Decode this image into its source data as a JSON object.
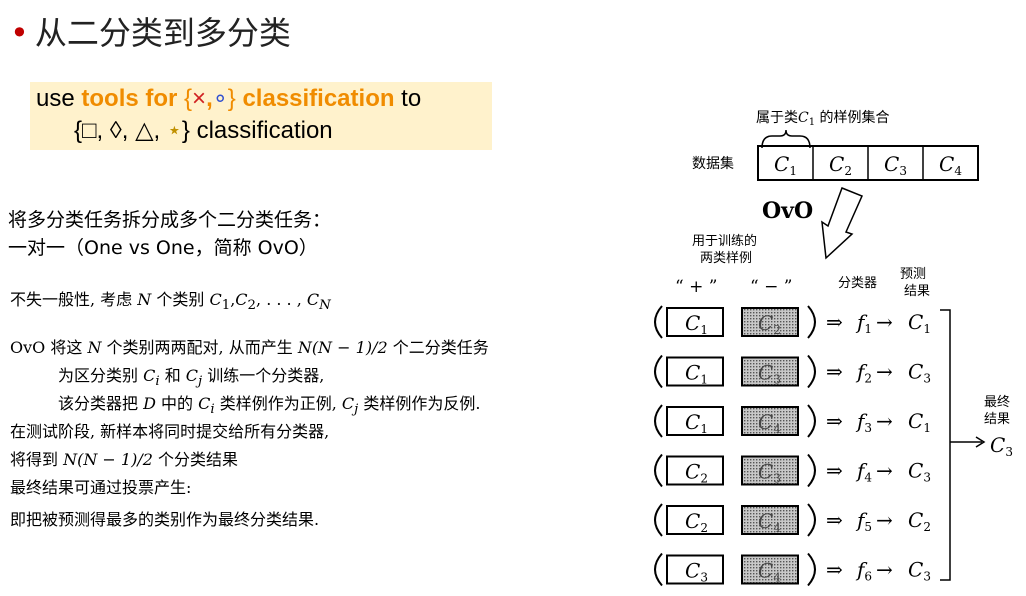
{
  "slide": {
    "bullet": "•",
    "title": "从二分类到多分类"
  },
  "use_box": {
    "w1": "use ",
    "w2": "tools for ",
    "open_brace": "{",
    "cross": "×",
    "comma": ",",
    "circle": "∘",
    "close_brace": "}",
    "w3": " classification",
    "w4": " to",
    "line2_open": "{",
    "square": "□",
    "c1": ", ",
    "diamond": "◊",
    "c2": ", ",
    "triangle": "△",
    "c3": ", ",
    "star": "⋆",
    "line2_close": "}",
    "line2_text": " classification"
  },
  "task": {
    "line1": "将多分类任务拆分成多个二分类任务：",
    "line2": "一对一（One vs One，简称 OvO）"
  },
  "body": {
    "l1_a": "不失一般性, 考虑 ",
    "l1_n": "N",
    "l1_b": " 个类别 ",
    "l1_c": "C",
    "l1_s1": "1",
    "l1_comma1": ",",
    "l1_c2": "C",
    "l1_s2": "2",
    "l1_dots": ", . . . , ",
    "l1_cn": "C",
    "l1_sn": "N",
    "l2_a": "OvO 将这 ",
    "l2_n": "N",
    "l2_b": " 个类别两两配对, 从而产生 ",
    "l2_formula": "N(N − 1)/2",
    "l2_c": " 个二分类任务",
    "l3_a": "为区分类别 ",
    "l3_ci": "C",
    "l3_i": "i",
    "l3_b": " 和 ",
    "l3_cj": "C",
    "l3_j": "j",
    "l3_c": " 训练一个分类器,",
    "l4_a": "该分类器把 ",
    "l4_d": "D",
    "l4_b": " 中的 ",
    "l4_ci": "C",
    "l4_i": "i",
    "l4_c": " 类样例作为正例, ",
    "l4_cj": "C",
    "l4_j": "j",
    "l4_d2": " 类样例作为反例.",
    "l5": "在测试阶段, 新样本将同时提交给所有分类器,",
    "l6_a": "将得到 ",
    "l6_formula": "N(N − 1)/2",
    "l6_b": " 个分类结果",
    "l7": "最终结果可通过投票产生:",
    "l8": "即把被预测得最多的类别作为最终分类结果."
  },
  "diagram": {
    "dataset_label": "数据集",
    "subset_label": "属于类",
    "subset_c": "C",
    "subset_sub": "1",
    "subset_tail": " 的样例集合",
    "dataset": [
      {
        "c": "C",
        "sub": "1"
      },
      {
        "c": "C",
        "sub": "2"
      },
      {
        "c": "C",
        "sub": "3"
      },
      {
        "c": "C",
        "sub": "4"
      }
    ],
    "ovo": "OvO",
    "train_line1": "用于训练的",
    "train_line2": "两类样例",
    "plus": "“ + ”",
    "minus": "“ − ”",
    "classifier": "分类器",
    "pred1": "预测",
    "pred2": "结果",
    "final1": "最终",
    "final2": "结果",
    "final_c": "C",
    "final_sub": "3",
    "rows": [
      {
        "pos": "1",
        "neg": "2",
        "f": "1",
        "r": "1"
      },
      {
        "pos": "1",
        "neg": "3",
        "f": "2",
        "r": "3"
      },
      {
        "pos": "1",
        "neg": "4",
        "f": "3",
        "r": "1"
      },
      {
        "pos": "2",
        "neg": "3",
        "f": "4",
        "r": "3"
      },
      {
        "pos": "2",
        "neg": "4",
        "f": "5",
        "r": "2"
      },
      {
        "pos": "3",
        "neg": "4",
        "f": "6",
        "r": "3"
      }
    ],
    "c": "C",
    "f": "f",
    "arrow1": "⇒",
    "arrow2": "→"
  }
}
